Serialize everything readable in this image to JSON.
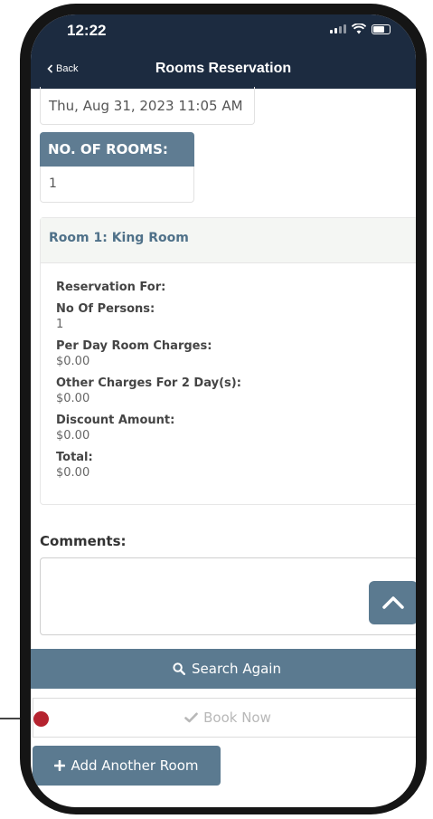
{
  "status_bar": {
    "time": "12:22"
  },
  "header": {
    "back_label": "Back",
    "title": "Rooms Reservation"
  },
  "reservation": {
    "date_value": "Thu, Aug 31, 2023 11:05 AM",
    "rooms_label": "NO. OF ROOMS:",
    "rooms_value": "1"
  },
  "room_card": {
    "title": "Room 1: King Room",
    "fields": [
      {
        "label": "Reservation For:",
        "value": ""
      },
      {
        "label": "No Of Persons:",
        "value": "1"
      },
      {
        "label": "Per Day Room Charges:",
        "value": "$0.00"
      },
      {
        "label": "Other Charges For 2 Day(s):",
        "value": "$0.00"
      },
      {
        "label": "Discount Amount:",
        "value": "$0.00"
      },
      {
        "label": "Total:",
        "value": "$0.00"
      }
    ]
  },
  "comments": {
    "label": "Comments:",
    "value": ""
  },
  "actions": {
    "search_again": "Search Again",
    "book_now": "Book Now",
    "add_room": "Add Another Room"
  },
  "icons": {
    "search": "search-icon",
    "check": "check-icon",
    "plus": "plus-icon",
    "scroll_up": "chevron-up-icon",
    "back": "chevron-left-icon"
  },
  "colors": {
    "header_bg": "#1c2b40",
    "accent": "#5b7a90",
    "room_title": "#4f7189",
    "annotation_dot": "#b5232f"
  }
}
